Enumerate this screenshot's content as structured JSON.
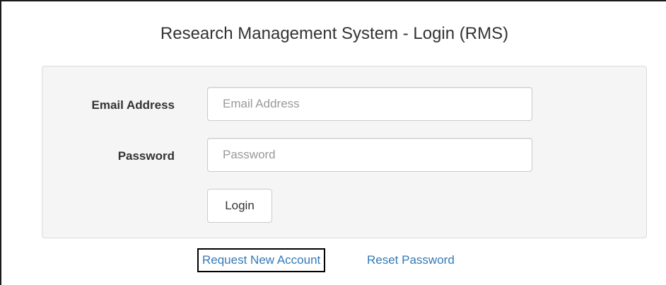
{
  "page": {
    "title": "Research Management System - Login (RMS)"
  },
  "form": {
    "email": {
      "label": "Email Address",
      "placeholder": "Email Address",
      "value": ""
    },
    "password": {
      "label": "Password",
      "placeholder": "Password",
      "value": ""
    },
    "login_button": "Login"
  },
  "links": {
    "request_account": "Request New Account",
    "reset_password": "Reset Password"
  },
  "colors": {
    "link": "#337ab7",
    "panel_background": "#f5f5f5",
    "panel_border": "#dcdcdc",
    "text": "#333333",
    "focus_outline": "#000000"
  }
}
